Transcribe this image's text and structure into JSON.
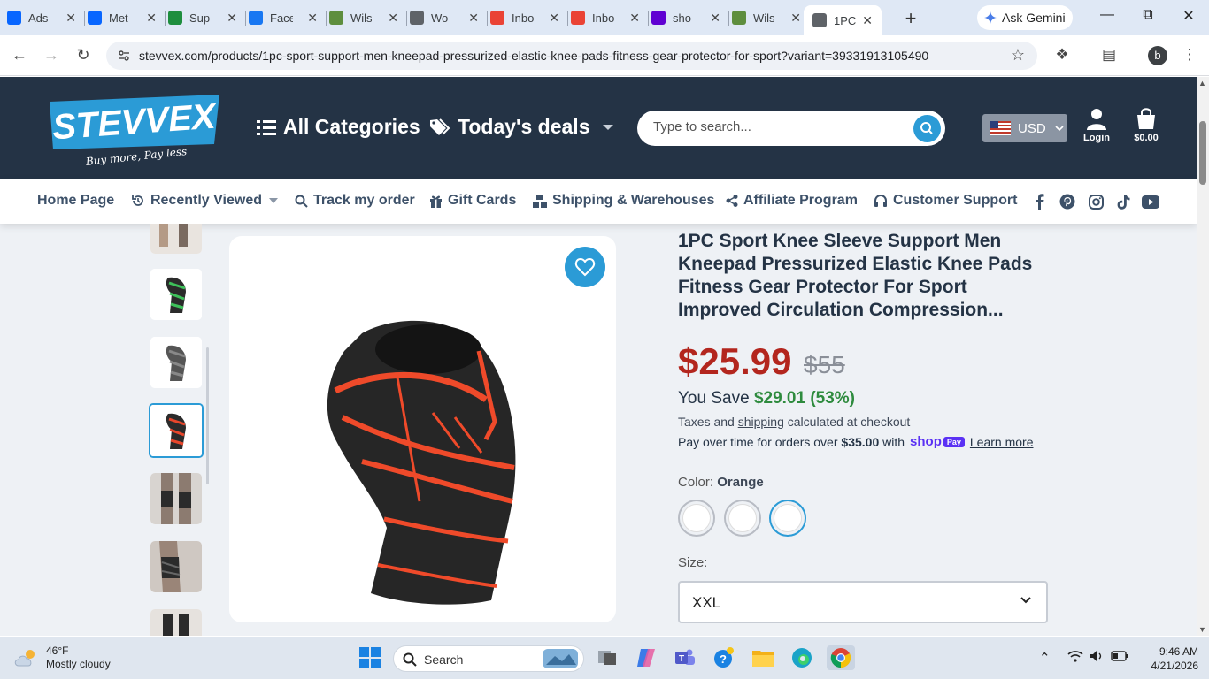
{
  "browser": {
    "tabs": [
      {
        "title": "Ads",
        "favicon": "meta-icon",
        "color": "#0866ff"
      },
      {
        "title": "Met",
        "favicon": "meta-icon",
        "color": "#0866ff"
      },
      {
        "title": "Sup",
        "favicon": "sheet-icon",
        "color": "#1e8e3e"
      },
      {
        "title": "Face",
        "favicon": "facebook-icon",
        "color": "#1877f2"
      },
      {
        "title": "Wils",
        "favicon": "shopify-icon",
        "color": "#5e8e3e"
      },
      {
        "title": "Wo",
        "favicon": "globe-icon",
        "color": "#5f6368"
      },
      {
        "title": "Inbo",
        "favicon": "gmail-icon",
        "color": "#ea4335"
      },
      {
        "title": "Inbo",
        "favicon": "gmail-icon",
        "color": "#ea4335"
      },
      {
        "title": "sho",
        "favicon": "yahoo-icon",
        "color": "#6001d2"
      },
      {
        "title": "Wils",
        "favicon": "shopify-icon",
        "color": "#5e8e3e"
      },
      {
        "title": "1PC",
        "favicon": "globe-icon",
        "color": "#5f6368",
        "active": true
      }
    ],
    "ask_gemini": "Ask Gemini",
    "url": "stevvex.com/products/1pc-sport-support-men-kneepad-pressurized-elastic-knee-pads-fitness-gear-protector-for-sport?variant=39331913105490",
    "profile_initial": "b"
  },
  "store": {
    "logo_text": "STEVVEX",
    "logo_tagline": "Buy more, Pay less",
    "all_categories": "All Categories",
    "todays_deals": "Today's deals",
    "search_placeholder": "Type to search...",
    "currency": "USD",
    "login": "Login",
    "cart_total": "$0.00",
    "accent": "#2b9bd6",
    "header_bg": "#243345"
  },
  "subnav": {
    "home": "Home Page",
    "recently_viewed": "Recently Viewed",
    "track_order": "Track my order",
    "gift_cards": "Gift Cards",
    "shipping": "Shipping & Warehouses",
    "affiliate": "Affiliate Program",
    "support": "Customer Support",
    "social": [
      "facebook-icon",
      "pinterest-icon",
      "instagram-icon",
      "tiktok-icon",
      "youtube-icon"
    ]
  },
  "product": {
    "title": "1PC Sport Knee Sleeve Support Men Kneepad Pressurized Elastic Knee Pads Fitness Gear Protector For Sport Improved Circulation Compression...",
    "price": "$25.99",
    "compare_price": "$55",
    "you_save_label": "You Save",
    "you_save_value": "$29.01 (53%)",
    "tax_prefix": "Taxes and",
    "tax_link": "shipping",
    "tax_suffix": "calculated at checkout",
    "pay_over_prefix": "Pay over time for orders over",
    "pay_over_amount": "$35.00",
    "pay_over_with": "with",
    "shop_pay_brand": "shop",
    "shop_pay_badge": "Pay",
    "learn_more": "Learn more",
    "color_label": "Color:",
    "color_value": "Orange",
    "size_label": "Size:",
    "size_value": "XXL"
  },
  "taskbar": {
    "temp": "46°F",
    "weather": "Mostly cloudy",
    "search": "Search",
    "time": "9:46 AM",
    "date": "4/21/2026"
  }
}
